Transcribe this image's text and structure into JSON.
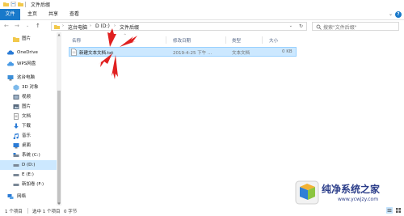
{
  "window": {
    "title": "文件后缀"
  },
  "ribbon": {
    "tabs": [
      "文件",
      "主页",
      "共享",
      "查看"
    ]
  },
  "address": {
    "crumbs": [
      "这台电脑",
      "D (D:)",
      "文件后缀"
    ],
    "search_placeholder": "搜索\"文件后缀\""
  },
  "nav": {
    "items": [
      {
        "label": "图片",
        "icon": "folder-icon"
      },
      {
        "label": "OneDrive",
        "icon": "cloud-icon"
      },
      {
        "label": "WPS网盘",
        "icon": "cloud-icon"
      },
      {
        "label": "这台电脑",
        "icon": "computer-icon"
      },
      {
        "label": "3D 对象",
        "icon": "3d-objects-icon"
      },
      {
        "label": "视频",
        "icon": "video-icon"
      },
      {
        "label": "图片",
        "icon": "picture-icon"
      },
      {
        "label": "文档",
        "icon": "document-icon"
      },
      {
        "label": "下载",
        "icon": "download-icon"
      },
      {
        "label": "音乐",
        "icon": "music-icon"
      },
      {
        "label": "桌面",
        "icon": "desktop-icon"
      },
      {
        "label": "系统 (C:)",
        "icon": "drive-icon"
      },
      {
        "label": "D (D:)",
        "icon": "drive-icon"
      },
      {
        "label": "E (E:)",
        "icon": "drive-icon"
      },
      {
        "label": "新加卷 (F:)",
        "icon": "drive-icon"
      },
      {
        "label": "网络",
        "icon": "network-icon"
      }
    ]
  },
  "columns": {
    "name": "名称",
    "date": "修改日期",
    "type": "类型",
    "size": "大小"
  },
  "files": [
    {
      "name": "新建文本文档.txt",
      "date": "2019-4-25 下午 ...",
      "type": "文本文档",
      "size": "0 KB"
    }
  ],
  "status": {
    "count": "1 个项目",
    "selected": "选中 1 个项目",
    "size": "0 字节"
  },
  "watermark": {
    "name": "纯净系统之家",
    "url": "www.ycwjzy.com"
  },
  "colors": {
    "accent": "#1979ca",
    "selection": "#cce8ff",
    "arrow": "#e02020"
  }
}
